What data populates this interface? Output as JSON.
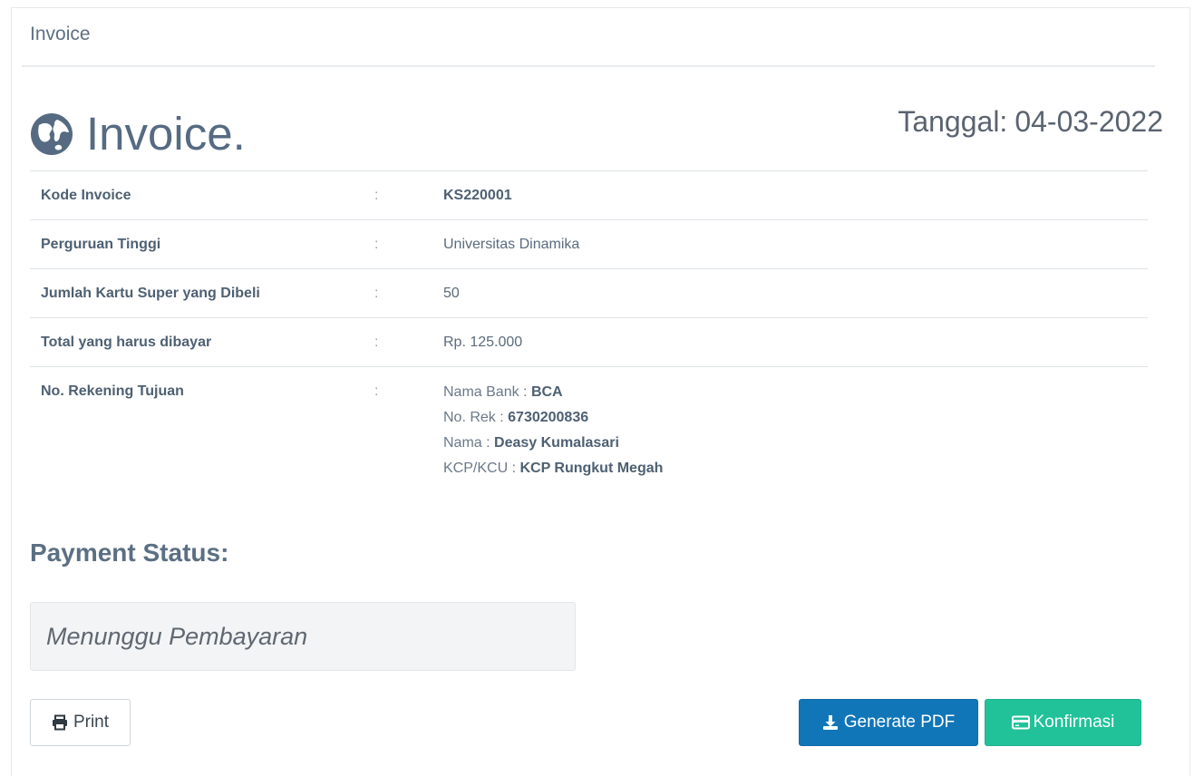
{
  "breadcrumb": "Invoice",
  "header": {
    "title": "Invoice.",
    "date_label": "Tanggal:",
    "date_value": "04-03-2022"
  },
  "details": {
    "separator": ":",
    "rows": [
      {
        "label": "Kode Invoice",
        "value": "KS220001"
      },
      {
        "label": "Perguruan Tinggi",
        "value": "Universitas Dinamika"
      },
      {
        "label": "Jumlah Kartu Super yang Dibeli",
        "value": "50"
      },
      {
        "label": "Total yang harus dibayar",
        "value": "Rp. 125.000"
      },
      {
        "label": "No. Rekening Tujuan"
      }
    ],
    "bank": {
      "bank_name_label": "Nama Bank :",
      "bank_name": "BCA",
      "account_no_label": "No. Rek :",
      "account_no": "6730200836",
      "holder_label": "Nama :",
      "holder": "Deasy Kumalasari",
      "branch_label": "KCP/KCU :",
      "branch": "KCP Rungkut Megah"
    }
  },
  "payment": {
    "heading": "Payment Status:",
    "status": "Menunggu Pembayaran"
  },
  "buttons": {
    "print": "Print",
    "generate_pdf": "Generate PDF",
    "konfirmasi": "Konfirmasi"
  },
  "icons": {
    "globe": "globe-icon",
    "print": "print-icon",
    "download": "download-icon",
    "credit_card": "credit-card-icon"
  },
  "colors": {
    "primary": "#1176b8",
    "success": "#21c299",
    "title": "#566b82"
  }
}
